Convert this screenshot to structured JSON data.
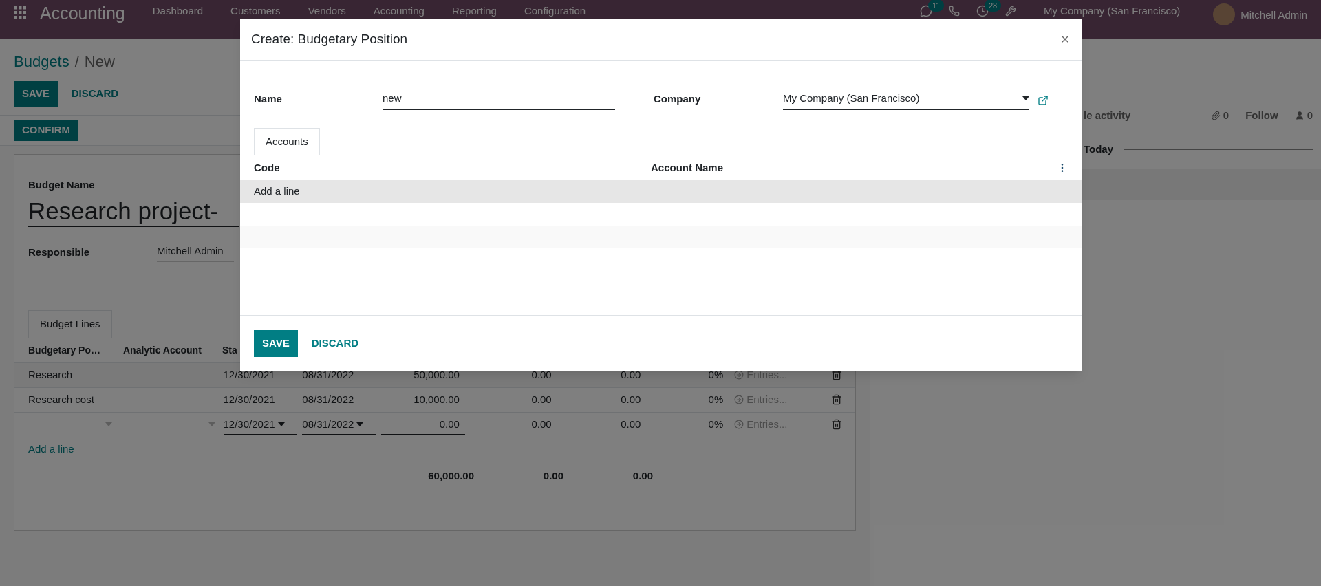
{
  "nav": {
    "app_title": "Accounting",
    "menu": [
      "Dashboard",
      "Customers",
      "Vendors",
      "Accounting",
      "Reporting",
      "Configuration"
    ],
    "chat_badge": "11",
    "activity_badge": "28",
    "company": "My Company (San Francisco)",
    "user": "Mitchell Admin"
  },
  "breadcrumb": {
    "parent": "Budgets",
    "separator": "/",
    "current": "New"
  },
  "control_buttons": {
    "save": "SAVE",
    "discard": "DISCARD",
    "confirm": "CONFIRM"
  },
  "form": {
    "budget_name_label": "Budget Name",
    "budget_name": "Research project-",
    "responsible_label": "Responsible",
    "responsible": "Mitchell Admin"
  },
  "tabs": [
    {
      "label": "Budget Lines",
      "selected": true
    }
  ],
  "budget_lines": {
    "columns": [
      "Budgetary Po…",
      "Analytic Account",
      "Sta"
    ],
    "rows": [
      {
        "kind": "saved",
        "position": "Research",
        "start": "12/30/2021",
        "end": "08/31/2022",
        "planned": "50,000.00",
        "practical": "0.00",
        "theoretical": "0.00",
        "achievement": "0%",
        "entries": "Entries..."
      },
      {
        "kind": "saved",
        "position": "Research cost",
        "start": "12/30/2021",
        "end": "08/31/2022",
        "planned": "10,000.00",
        "practical": "0.00",
        "theoretical": "0.00",
        "achievement": "0%",
        "entries": "Entries..."
      },
      {
        "kind": "editing",
        "start": "12/30/2021",
        "end": "08/31/2022",
        "planned": "0.00",
        "practical": "0.00",
        "theoretical": "0.00",
        "achievement": "0%",
        "entries": "Entries..."
      }
    ],
    "add_line": "Add a line",
    "totals": [
      "60,000.00",
      "0.00",
      "0.00"
    ]
  },
  "chatter": {
    "schedule": "le activity",
    "attachments": "0",
    "follow": "Follow",
    "followers": "0",
    "today": "Today"
  },
  "dialog": {
    "title": "Create: Budgetary Position",
    "name_label": "Name",
    "name_value": "new",
    "company_label": "Company",
    "company_value": "My Company (San Francisco)",
    "tabs": [
      {
        "label": "Accounts",
        "selected": true
      }
    ],
    "columns": [
      "Code",
      "Account Name"
    ],
    "add_line": "Add a line",
    "save": "SAVE",
    "discard": "DISCARD"
  }
}
